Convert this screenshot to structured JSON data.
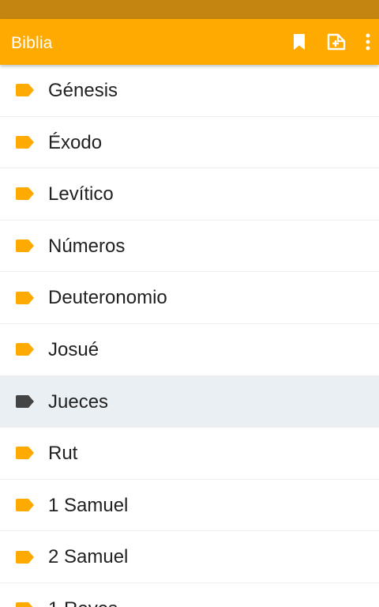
{
  "app": {
    "title": "Biblia"
  },
  "colors": {
    "status_bar": "#c58511",
    "app_bar": "#ffaa00",
    "tag_default": "#ffaa00",
    "tag_selected": "#444444",
    "selected_row_bg": "#eaeff3"
  },
  "toolbar": {
    "icons": [
      "bookmark-icon",
      "add-note-icon",
      "more-options-icon"
    ]
  },
  "books": [
    {
      "label": "Génesis",
      "selected": false
    },
    {
      "label": "Éxodo",
      "selected": false
    },
    {
      "label": "Levítico",
      "selected": false
    },
    {
      "label": "Números",
      "selected": false
    },
    {
      "label": "Deuteronomio",
      "selected": false
    },
    {
      "label": "Josué",
      "selected": false
    },
    {
      "label": "Jueces",
      "selected": true
    },
    {
      "label": "Rut",
      "selected": false
    },
    {
      "label": "1 Samuel",
      "selected": false
    },
    {
      "label": "2 Samuel",
      "selected": false
    },
    {
      "label": "1 Reyes",
      "selected": false
    }
  ]
}
